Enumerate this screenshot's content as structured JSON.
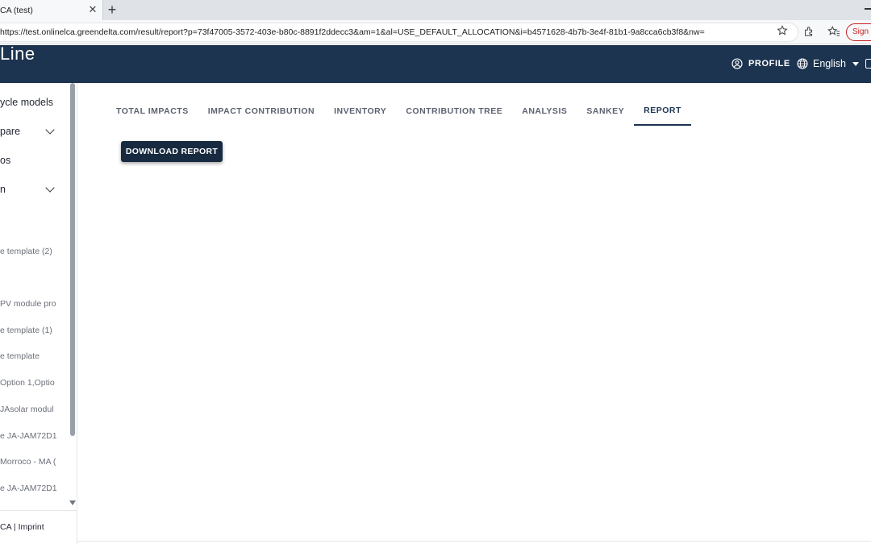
{
  "browser": {
    "tab_title": "CA (test)",
    "tab_close": "✕",
    "new_tab": "+",
    "url": "https://test.onlinelca.greendelta.com/result/report?p=73f47005-3572-403e-b80c-8891f2ddecc3&am=1&al=USE_DEFAULT_ALLOCATION&i=b4571628-4b7b-3e4f-81b1-9a8cca6cb3f8&nw=",
    "signin_label": "Sign in"
  },
  "header": {
    "logo_text": "Line",
    "profile_label": "PROFILE",
    "language_label": "English"
  },
  "sidebar": {
    "items": [
      {
        "label": "ycle models"
      },
      {
        "label": "pare"
      },
      {
        "label": "os"
      },
      {
        "label": "n"
      }
    ],
    "recent": [
      "e template (2)",
      "PV module pro",
      "e template (1)",
      "e template",
      "Option 1,Optio",
      "JAsolar modul",
      "e JA-JAM72D1",
      "Morroco - MA (",
      "e JA-JAM72D1"
    ],
    "footer": "CA  |  Imprint"
  },
  "main": {
    "tabs": [
      {
        "label": "TOTAL IMPACTS"
      },
      {
        "label": "IMPACT CONTRIBUTION"
      },
      {
        "label": "INVENTORY"
      },
      {
        "label": "CONTRIBUTION TREE"
      },
      {
        "label": "ANALYSIS"
      },
      {
        "label": "SANKEY"
      },
      {
        "label": "REPORT"
      }
    ],
    "active_tab": "REPORT",
    "download_label": "DOWNLOAD REPORT"
  },
  "colors": {
    "header_bg": "#1d3450",
    "button_bg": "#172a40",
    "signin": "#c5221f"
  },
  "icons": [
    "star-icon",
    "extensions-icon",
    "favorites-icon",
    "profile-icon",
    "globe-icon",
    "logout-icon",
    "chevron-down-icon"
  ]
}
